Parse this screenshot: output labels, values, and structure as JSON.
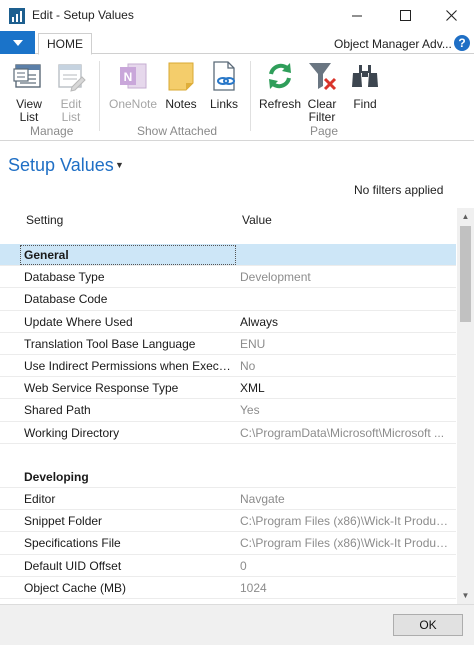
{
  "window": {
    "title": "Edit - Setup Values",
    "minimize_glyph": "—",
    "maximize_glyph": "☐",
    "close_glyph": "✕"
  },
  "ribbon": {
    "app_menu_glyph": "▾",
    "tab_home": "HOME",
    "company": "Object Manager Adv...",
    "help_glyph": "?",
    "buttons": {
      "view_list": "View\nList",
      "edit_list": "Edit\nList",
      "onenote": "OneNote",
      "notes": "Notes",
      "links": "Links",
      "refresh": "Refresh",
      "clear_filter": "Clear\nFilter",
      "find": "Find"
    },
    "groups": {
      "manage": "Manage",
      "show_attached": "Show Attached",
      "page": "Page"
    }
  },
  "page": {
    "title": "Setup Values",
    "title_caret": "▼",
    "filters_text": "No filters applied"
  },
  "columns": {
    "setting": "Setting",
    "value": "Value"
  },
  "rows": [
    {
      "setting": "General",
      "value": "",
      "group": true
    },
    {
      "setting": "Database Type",
      "value": "Development",
      "dim": true
    },
    {
      "setting": "Database Code",
      "value": ""
    },
    {
      "setting": "Update Where Used",
      "value": "Always",
      "dim": false
    },
    {
      "setting": "Translation Tool Base Language",
      "value": "ENU",
      "dim": true
    },
    {
      "setting": "Use Indirect Permissions when Executin...",
      "value": "No",
      "dim": true
    },
    {
      "setting": "Web Service Response Type",
      "value": "XML",
      "dim": false
    },
    {
      "setting": "Shared Path",
      "value": "Yes",
      "dim": true
    },
    {
      "setting": "Working Directory",
      "value": "C:\\ProgramData\\Microsoft\\Microsoft ...",
      "dim": true
    },
    {
      "setting": "",
      "value": "",
      "blank": true
    },
    {
      "setting": "Developing",
      "value": "",
      "group": true
    },
    {
      "setting": "Editor",
      "value": "Navgate",
      "dim": true
    },
    {
      "setting": "Snippet Folder",
      "value": "C:\\Program Files (x86)\\Wick-It Product...",
      "dim": true
    },
    {
      "setting": "Specifications File",
      "value": "C:\\Program Files (x86)\\Wick-It Product...",
      "dim": true
    },
    {
      "setting": "Default UID Offset",
      "value": "0",
      "dim": true
    },
    {
      "setting": "Object Cache (MB)",
      "value": "1024",
      "dim": true
    }
  ],
  "scroll": {
    "up_glyph": "▲",
    "down_glyph": "▼"
  },
  "footer": {
    "ok": "OK"
  }
}
